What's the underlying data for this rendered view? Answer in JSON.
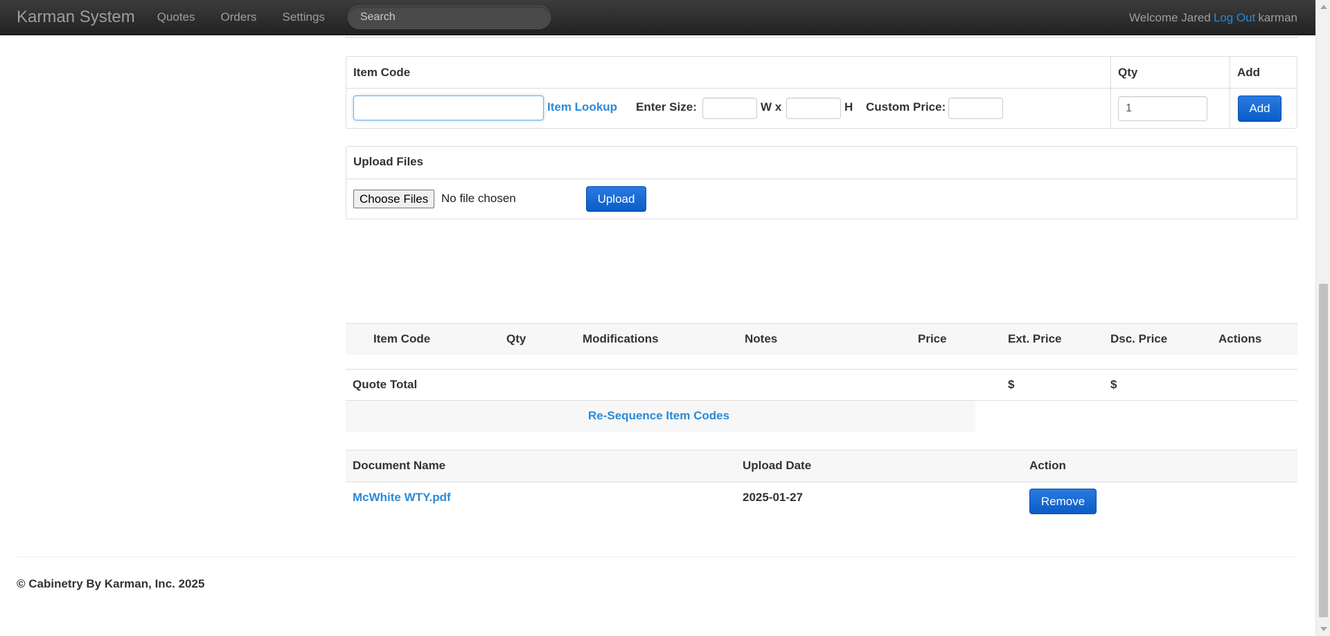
{
  "navbar": {
    "brand": "Karman System",
    "links": [
      "Quotes",
      "Orders",
      "Settings"
    ],
    "search_placeholder": "Search",
    "welcome": "Welcome Jared",
    "logout": "Log Out",
    "username": "karman"
  },
  "item_entry": {
    "item_code_header": "Item Code",
    "qty_header": "Qty",
    "add_header": "Add",
    "item_lookup": "Item Lookup",
    "enter_size_label": "Enter Size:",
    "width_label": "W x",
    "height_label": "H",
    "custom_price_label": "Custom Price:",
    "qty_value": "1",
    "add_button": "Add"
  },
  "upload": {
    "title": "Upload Files",
    "choose_button": "Choose Files",
    "no_file_text": "No file chosen",
    "upload_button": "Upload"
  },
  "items_table": {
    "columns": [
      "Item Code",
      "Qty",
      "Modifications",
      "Notes",
      "Price",
      "Ext. Price",
      "Dsc. Price",
      "Actions"
    ],
    "quote_total_label": "Quote Total",
    "ext_total": "$",
    "dsc_total": "$",
    "resequence_link": "Re-Sequence Item Codes"
  },
  "documents": {
    "columns": [
      "Document Name",
      "Upload Date",
      "Action"
    ],
    "rows": [
      {
        "name": "McWhite WTY.pdf",
        "date": "2025-01-27",
        "action": "Remove"
      }
    ]
  },
  "footer": {
    "copyright": "© Cabinetry By Karman, Inc. 2025"
  }
}
